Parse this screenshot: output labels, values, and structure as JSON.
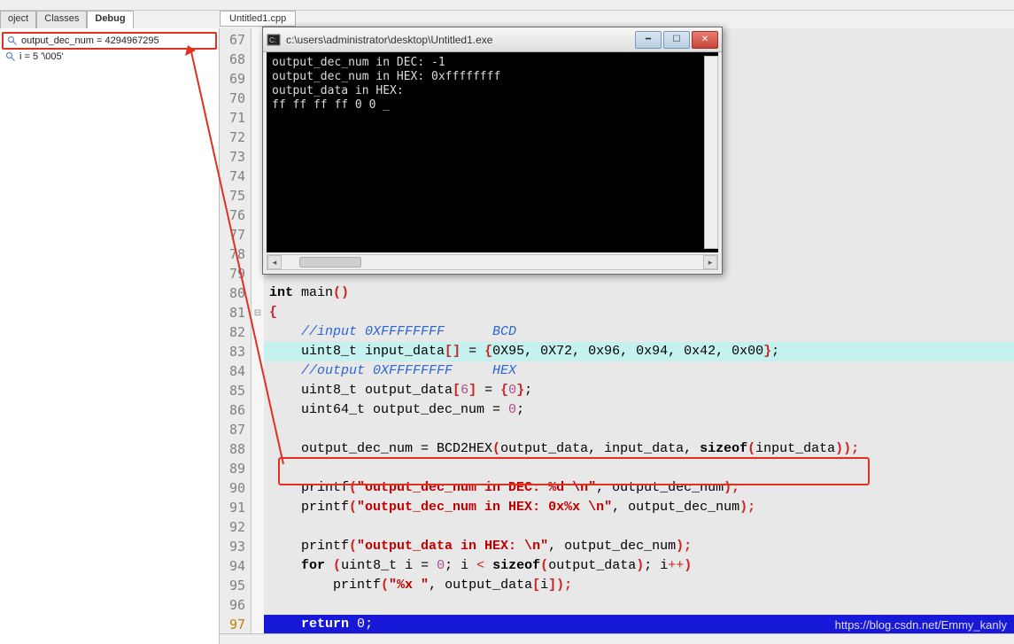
{
  "tabs_left": {
    "project": "oject",
    "classes": "Classes",
    "debug": "Debug"
  },
  "watch": {
    "item1": "output_dec_num = 4294967295",
    "item2": "i = 5 '\\005'"
  },
  "filetab": "Untitled1.cpp",
  "gutter": [
    "67",
    "68",
    "69",
    "70",
    "71",
    "72",
    "73",
    "74",
    "75",
    "76",
    "77",
    "78",
    "79",
    "80",
    "81",
    "82",
    "83",
    "84",
    "85",
    "86",
    "87",
    "88",
    "89",
    "90",
    "91",
    "92",
    "93",
    "94",
    "95",
    "96",
    "97"
  ],
  "code": {
    "l80_a": "int",
    "l80_b": " main",
    "l80_c": "()",
    "l81": "{",
    "l82_a": "    ",
    "l82_b": "//input 0XFFFFFFFF      BCD",
    "l83_a": "    uint8_t input_data",
    "l83_b": "[]",
    "l83_c": " = ",
    "l83_d": "{",
    "l83_e": "0X95, 0X72, 0x96, 0x94, 0x42, 0x00",
    "l83_f": "}",
    "l83_g": ";",
    "l84_a": "    ",
    "l84_b": "//output 0XFFFFFFFF     HEX",
    "l85_a": "    uint8_t output_data",
    "l85_b": "[",
    "l85_c": "6",
    "l85_d": "]",
    "l85_e": " = ",
    "l85_f": "{",
    "l85_g": "0",
    "l85_h": "}",
    "l85_i": ";",
    "l86_a": "    uint64_t output_dec_num = ",
    "l86_b": "0",
    "l86_c": ";",
    "l88_a": "    output_dec_num = BCD2HEX",
    "l88_b": "(",
    "l88_c": "output_data, input_data, ",
    "l88_d": "sizeof",
    "l88_e": "(",
    "l88_f": "input_data",
    "l88_g": "));",
    "l90_a": "    printf",
    "l90_b": "(",
    "l90_c": "\"output_dec_num in DEC: %d \\n\"",
    "l90_d": ", output_dec_num",
    "l90_e": ");",
    "l91_a": "    printf",
    "l91_b": "(",
    "l91_c": "\"output_dec_num in HEX: 0x%x \\n\"",
    "l91_d": ", output_dec_num",
    "l91_e": ");",
    "l93_a": "    printf",
    "l93_b": "(",
    "l93_c": "\"output_data in HEX: \\n\"",
    "l93_d": ", output_dec_num",
    "l93_e": ");",
    "l94_a": "    ",
    "l94_b": "for",
    "l94_c": " ",
    "l94_d": "(",
    "l94_e": "uint8_t i = ",
    "l94_f": "0",
    "l94_g": "; i ",
    "l94_h": "<",
    "l94_i": " ",
    "l94_j": "sizeof",
    "l94_k": "(",
    "l94_l": "output_data",
    "l94_m": ")",
    "l94_n": "; i",
    "l94_o": "++",
    "l94_p": ")",
    "l95_a": "        printf",
    "l95_b": "(",
    "l95_c": "\"%x \"",
    "l95_d": ", output_data",
    "l95_e": "[",
    "l95_f": "i",
    "l95_g": "]);",
    "l97_a": "    ",
    "l97_b": "return",
    "l97_c": " ",
    "l97_d": "0",
    "l97_e": ";"
  },
  "console": {
    "title": "c:\\users\\administrator\\desktop\\Untitled1.exe",
    "lines": [
      "output_dec_num in DEC: -1",
      "output_dec_num in HEX: 0xffffffff",
      "output_data in HEX:",
      "ff ff ff ff 0 0 _"
    ]
  },
  "watermark": "https://blog.csdn.net/Emmy_kanly"
}
